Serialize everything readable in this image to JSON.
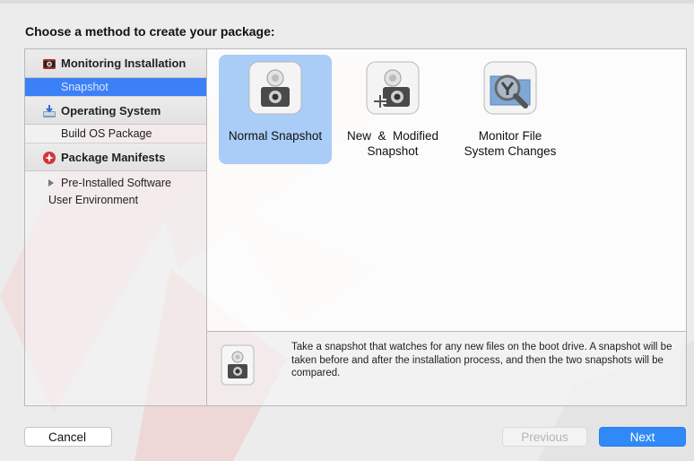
{
  "heading": "Choose a method to create your package:",
  "sidebar": {
    "sections": [
      {
        "label": "Monitoring Installation",
        "icon": "camera-icon"
      },
      {
        "label": "Operating System",
        "icon": "install-disk-icon"
      },
      {
        "label": "Package Manifests",
        "icon": "manifest-badge-icon"
      }
    ],
    "snapshot_item": "Snapshot",
    "build_os_item": "Build OS Package",
    "tree": [
      {
        "label": "Pre-Installed Software"
      },
      {
        "label": "User Environment"
      }
    ]
  },
  "methods": [
    {
      "label": "Normal Snapshot",
      "icon": "snapshot-camera-icon",
      "selected": true
    },
    {
      "label": "New  &  Modified\nSnapshot",
      "line1": "New  &  Modified",
      "line2": "Snapshot",
      "icon": "snapshot-camera-plus-icon"
    },
    {
      "label": "Monitor File\nSystem Changes",
      "line1": "Monitor File",
      "line2": "System Changes",
      "icon": "folder-magnifier-icon"
    }
  ],
  "description": {
    "icon": "snapshot-camera-icon",
    "text": "Take a snapshot that watches for any new files on the boot drive. A snapshot will be taken before and after the installation process, and then the two snapshots will be compared."
  },
  "buttons": {
    "cancel": "Cancel",
    "previous": "Previous",
    "next": "Next"
  },
  "colors": {
    "selection_blue": "#3b80f6",
    "method_selected": "#a9cdf7",
    "next_button": "#2f8af8",
    "watermark_red": "#e8b7b7"
  }
}
